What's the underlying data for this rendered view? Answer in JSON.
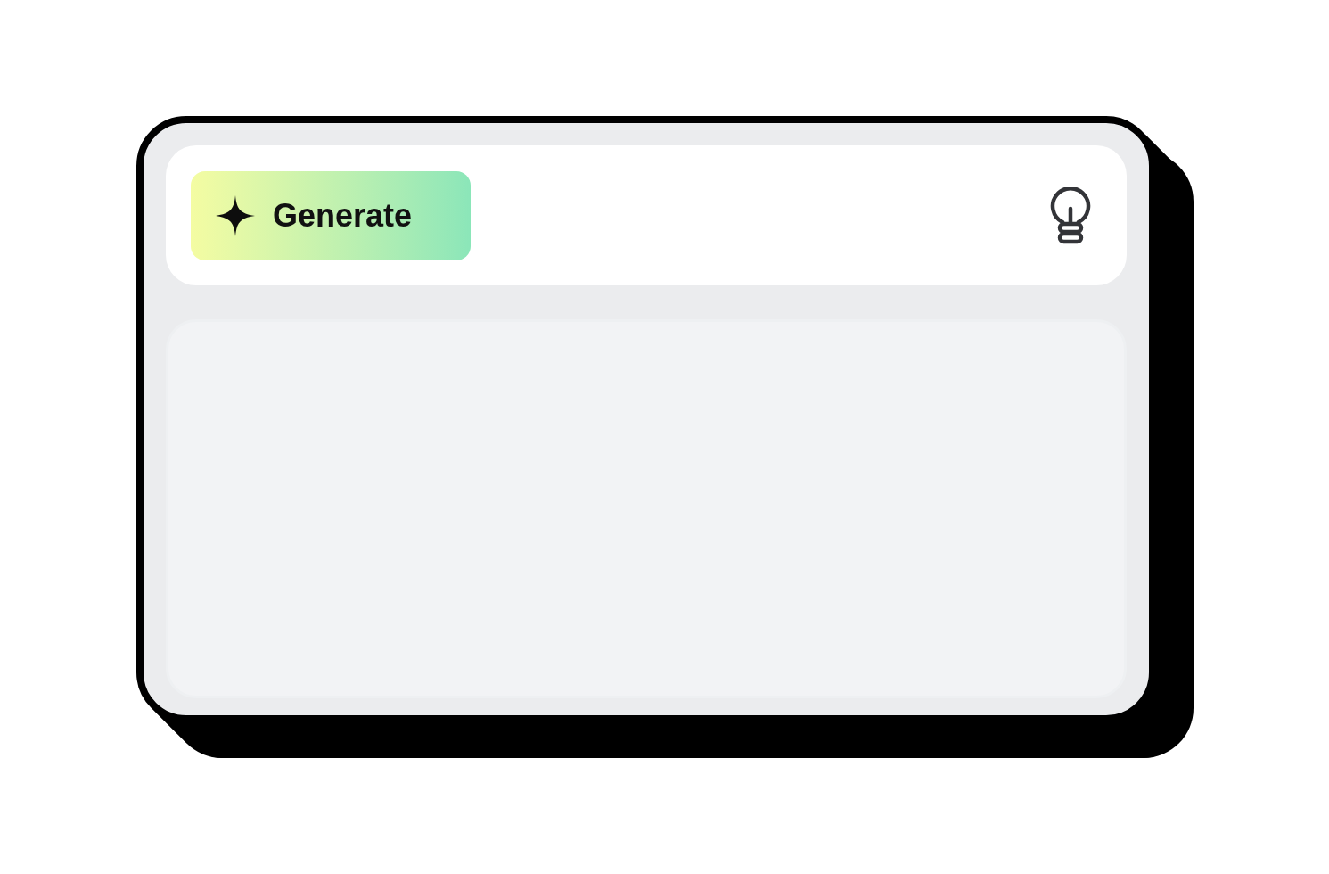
{
  "toolbar": {
    "generate_button": {
      "label": "Generate"
    }
  }
}
